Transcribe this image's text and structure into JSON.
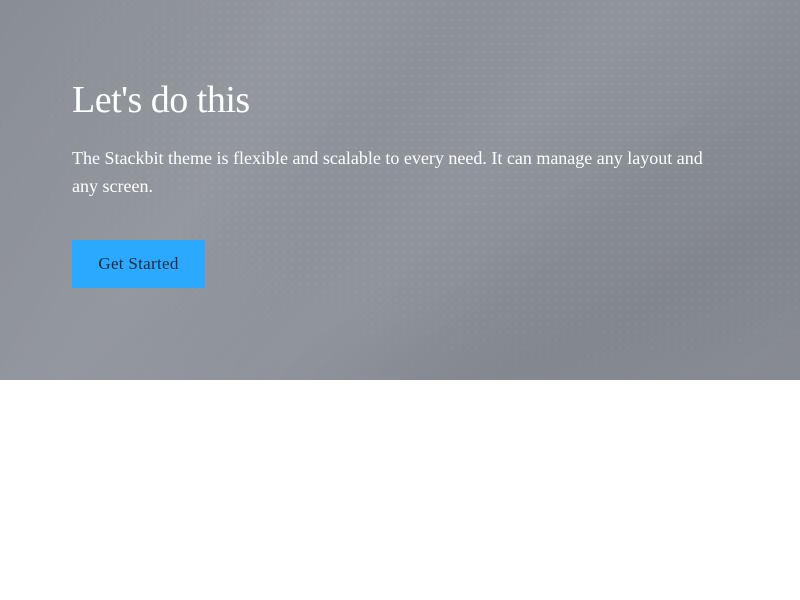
{
  "hero": {
    "title": "Let's do this",
    "text": "The Stackbit theme is flexible and scalable to every need. It can manage any layout and any screen.",
    "button_label": "Get Started"
  },
  "colors": {
    "hero_background": "#898d94",
    "button_background": "#2ba8ff",
    "button_text": "#1c2a3a",
    "page_background": "#ffffff"
  }
}
